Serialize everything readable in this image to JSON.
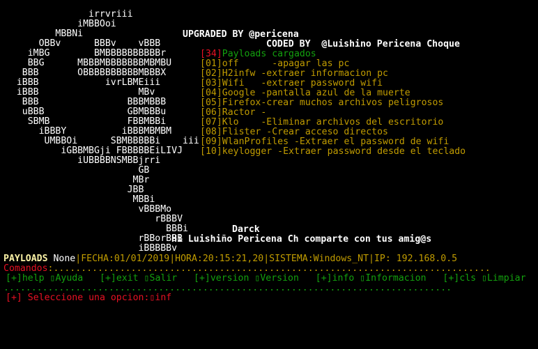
{
  "art": {
    "lines": [
      "                irrvriii",
      "              iMBBOoi",
      "          MBBNi",
      "       OBBv      BBBv    vBBB",
      "     iMBG        BMBBBBBBBBBBr",
      "     BBG      MBBBMBBBBBBBMBMBU",
      "    BBB       OBBBBBBBBBBMBBBX",
      "   iBBB            ivrLBMEiii",
      "   iBBB                  MBv",
      "    BBB                BBBMBBB",
      "    uBBB               GBMBBBu",
      "     SBMB              FBBMBBi",
      "       iBBBY          iBBBMBMBM",
      "        UMBBOi      SBMBBBBBi    iii",
      "           iGBBMBGji FBBBBBEiLIVJ",
      "              iUBBBBNSMBBjrri",
      "                         GB",
      "                        MBr",
      "                       JBB",
      "                        MBBi",
      "                         vBBBMo",
      "                            rBBBV",
      "                              BBBi",
      "                         rBBorBBB",
      "                         iBBBBBv"
    ]
  },
  "header": {
    "upgraded_by": "UPGRADED BY @pericena",
    "coded_by": "CODED BY  @Luishino Pericena Choque",
    "darck": "Darck",
    "greeting": "Hi Luishiño Pericena Ch comparte con tus amig@s"
  },
  "menu": {
    "count_badge": "[34]",
    "count_label": "Payloads cargados",
    "items": [
      {
        "code": "[01]",
        "name": "off",
        "desc": "      -apagar las pc"
      },
      {
        "code": "[02]",
        "name": "H2infw",
        "desc": " -extraer informacion pc"
      },
      {
        "code": "[03]",
        "name": "Wifi",
        "desc": "   -extraer password wifi"
      },
      {
        "code": "[04]",
        "name": "Google",
        "desc": " -pantalla azul de la muerte"
      },
      {
        "code": "[05]",
        "name": "Firefox",
        "desc": "-crear muchos archivos peligrosos"
      },
      {
        "code": "[06]",
        "name": "Ractor",
        "desc": " -"
      },
      {
        "code": "[07]",
        "name": "Klo",
        "desc": "    -Eliminar archivos del escritorio"
      },
      {
        "code": "[08]",
        "name": "Flister",
        "desc": " -Crear acceso directos"
      },
      {
        "code": "[09]",
        "name": "WlanProfiles",
        "desc": " -Extraer el password de wifi"
      },
      {
        "code": "[10]",
        "name": "keylogger",
        "desc": " -Extraer password desde el teclado"
      }
    ]
  },
  "status": {
    "payloads_label": "PAYLOADS",
    "payloads_value": "None",
    "info": "|FECHA:01/01/2019|HORA:20:15:21,20|SISTEMA:Windows_NT|IP: 192.168.0.5"
  },
  "commands": {
    "label": "Comandos",
    "dots": ":...............................................................................",
    "items": [
      {
        "key": "[+]help",
        "glyph": "▯",
        "label": "Ayuda"
      },
      {
        "key": "[+]exit",
        "glyph": "▯",
        "label": "Salir"
      },
      {
        "key": "[+]version",
        "glyph": "▯",
        "label": "Version"
      },
      {
        "key": "[+]info",
        "glyph": "▯",
        "label": "Informacion"
      },
      {
        "key": "[+]cls",
        "glyph": "▯",
        "label": "Limpiar"
      }
    ],
    "separator": "................................................................................."
  },
  "prompt": {
    "text": "[+] Seleccione una opcion:",
    "glyph": "▯",
    "input": "inf"
  },
  "colors": {
    "background": "#000000",
    "white": "#ffffff",
    "green": "#13a10e",
    "orange": "#c19c00",
    "red": "#e81123",
    "yellow": "#f9f1a5"
  }
}
